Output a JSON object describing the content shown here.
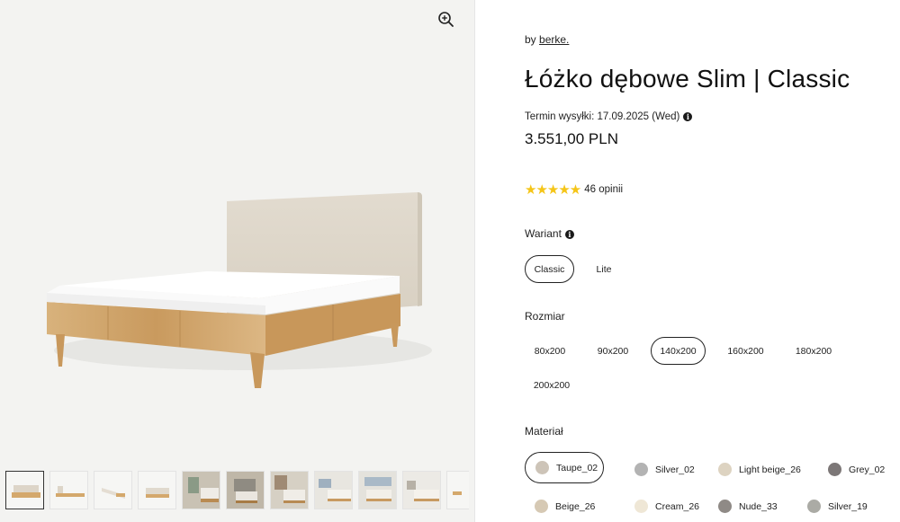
{
  "brand": {
    "prefix": "by",
    "name": "berke."
  },
  "product": {
    "title": "Łóżko dębowe Slim | Classic",
    "shipping": "Termin wysyłki: 17.09.2025 (Wed)",
    "price": "3.551,00 PLN",
    "rating_stars": "★★★★★",
    "rating_text": "46 opinii"
  },
  "variant": {
    "label": "Wariant",
    "options": [
      "Classic",
      "Lite"
    ],
    "selected": "Classic"
  },
  "size": {
    "label": "Rozmiar",
    "options": [
      "80x200",
      "90x200",
      "140x200",
      "160x200",
      "180x200",
      "200x200"
    ],
    "selected": "140x200"
  },
  "material": {
    "label": "Materiał",
    "options": [
      {
        "name": "Taupe_02",
        "color": "#cdc4b8"
      },
      {
        "name": "Silver_02",
        "color": "#b3b3b3"
      },
      {
        "name": "Light beige_26",
        "color": "#ddd3c1"
      },
      {
        "name": "Grey_02",
        "color": "#7c7777"
      },
      {
        "name": "Beige_26",
        "color": "#d6c9b4"
      },
      {
        "name": "Cream_26",
        "color": "#efe7d6"
      },
      {
        "name": "Nude_33",
        "color": "#8f8a86"
      },
      {
        "name": "Silver_19",
        "color": "#ababa5"
      }
    ],
    "selected": "Taupe_02"
  },
  "gallery": {
    "zoom_icon": "zoom-in-icon",
    "thumbnail_count": 11
  }
}
